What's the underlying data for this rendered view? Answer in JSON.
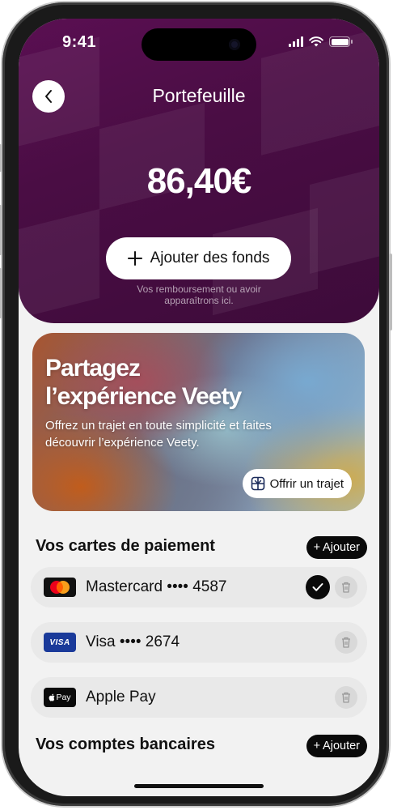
{
  "status_bar": {
    "time": "9:41"
  },
  "header": {
    "title": "Portefeuille",
    "balance": "86,40€",
    "add_funds_label": "Ajouter des fonds",
    "refund_note_line1": "Vos remboursement ou avoir",
    "refund_note_line2": "apparaîtrons ici."
  },
  "promo": {
    "title_line1": "Partagez",
    "title_line2": "l’expérience Veety",
    "text": "Offrez un trajet en toute simplicité et faites découvrir l’expérience Veety.",
    "button_label": "Offrir un trajet"
  },
  "payment_cards": {
    "section_title": "Vos cartes de paiement",
    "add_label": "Ajouter",
    "items": [
      {
        "name": "Mastercard •••• 4587",
        "logo": "mastercard",
        "selected": true
      },
      {
        "name": "Visa •••• 2674",
        "logo": "visa",
        "logo_text": "VISA",
        "selected": false
      },
      {
        "name": "Apple Pay",
        "logo": "apple-pay",
        "logo_text": "Pay",
        "selected": false
      }
    ]
  },
  "bank_accounts": {
    "section_title": "Vos comptes bancaires",
    "add_label": "Ajouter"
  },
  "colors": {
    "header_bg": "#4a0d44",
    "accent_dark": "#0a0a0a",
    "row_bg": "#e9e9e9",
    "visa_blue": "#1a3a9a",
    "mastercard_red": "#eb001b",
    "mastercard_orange": "#f79e1b"
  }
}
